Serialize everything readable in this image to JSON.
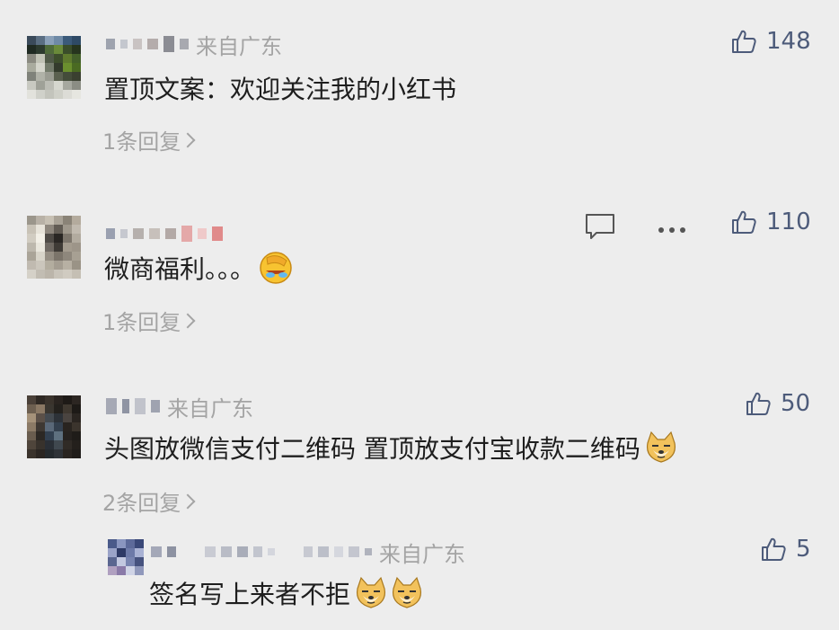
{
  "comments": [
    {
      "location": "来自广东",
      "text": "置顶文案：欢迎关注我的小红书",
      "replies": "1条回复",
      "likes": "148"
    },
    {
      "location": "",
      "text": "微商福利。。。",
      "replies": "1条回复",
      "likes": "110",
      "emoji": "facepalm-laugh-emoji"
    },
    {
      "location": "来自广东",
      "text": "头图放微信支付二维码 置顶放支付宝收款二维码",
      "replies": "2条回复",
      "likes": "50",
      "emoji": "doge-emoji"
    },
    {
      "location": "来自广东",
      "text": "签名写上来者不拒",
      "replies": "",
      "likes": "5",
      "emoji": "doge-emoji"
    }
  ],
  "icons": {
    "like": "thumbs-up-icon",
    "reply": "comment-bubble-icon",
    "more": "more-dots-icon"
  },
  "colors": {
    "background": "#ededed",
    "like_blue": "#4d5b7a",
    "meta_grey": "#a4a4a4",
    "text": "#1e1e1e"
  }
}
